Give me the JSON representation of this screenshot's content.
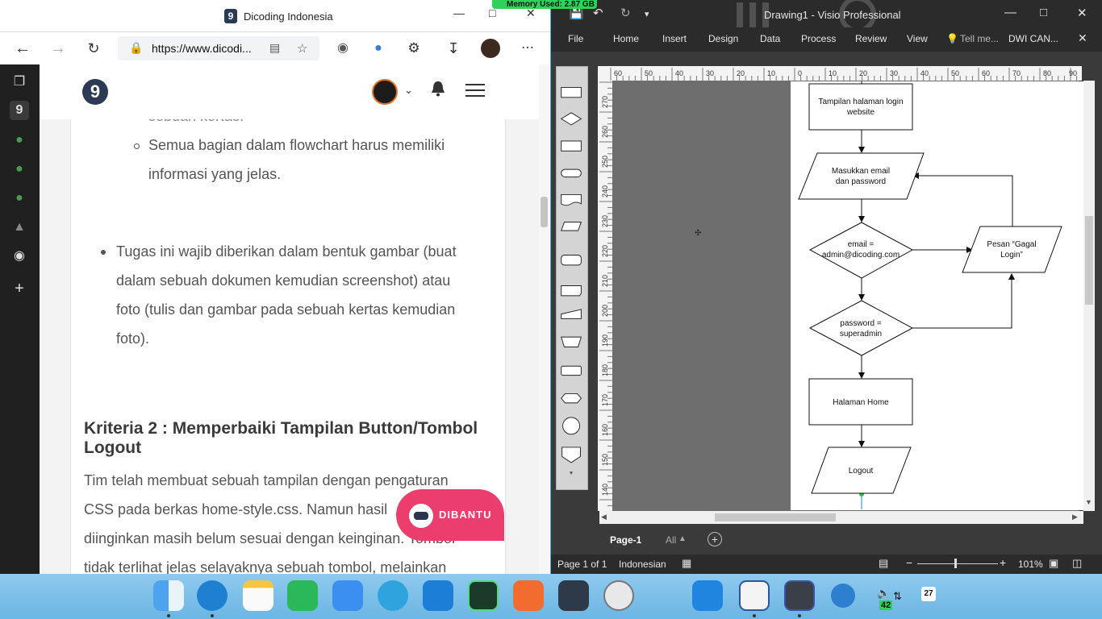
{
  "browser": {
    "tab_title": "Dicoding Indonesia",
    "url": "https://www.dicodi...",
    "memory_badge": "Memory Used: 2.87 GB",
    "article": {
      "cut_line": "sebuah kertas.",
      "sub_bullet": [
        "Semua bagian dalam flowchart harus memiliki",
        "informasi yang jelas."
      ],
      "bullet_lines": [
        "Tugas ini wajib diberikan dalam bentuk gambar (buat",
        "dalam sebuah dokumen kemudian screenshot) atau",
        "foto (tulis dan gambar pada sebuah kertas kemudian",
        "foto)."
      ],
      "heading": "Kriteria 2 : Memperbaiki Tampilan Button/Tombol Logout",
      "para_lines": [
        "Tim telah membuat sebuah tampilan dengan pengaturan",
        "CSS pada berkas home-style.css. Namun hasil",
        "diinginkan masih belum sesuai dengan keinginan. Tombol",
        "tidak terlihat jelas selayaknya sebuah tombol, melainkan"
      ]
    },
    "help_button": "DIBANTU"
  },
  "visio": {
    "window_title": "Drawing1 - Visio Professional",
    "ribbon_tabs": [
      "File",
      "Home",
      "Insert",
      "Design",
      "Data",
      "Process",
      "Review",
      "View"
    ],
    "tell_me": "Tell me...",
    "user": "DWI CAN...",
    "ruler_h": [
      "60",
      "50",
      "40",
      "30",
      "20",
      "10",
      "0",
      "10",
      "20",
      "30",
      "40",
      "50",
      "60",
      "70",
      "80",
      "90"
    ],
    "ruler_v": [
      "270",
      "260",
      "250",
      "240",
      "230",
      "220",
      "210",
      "200",
      "190",
      "180",
      "170",
      "160",
      "150",
      "140"
    ],
    "flowchart": {
      "step1": [
        "Tampilan halaman login",
        "website"
      ],
      "step2": [
        "Masukkan email",
        "dan password"
      ],
      "decision1": [
        "email =",
        "admin@dicoding.com"
      ],
      "fail": [
        "Pesan “Gagal",
        "Login”"
      ],
      "decision2": [
        "password =",
        "superadmin"
      ],
      "home": "Halaman Home",
      "logout": "Logout"
    },
    "page_tab": "Page-1",
    "all_tab": "All",
    "status": {
      "page": "Page 1 of 1",
      "language": "Indonesian",
      "zoom": "101%"
    }
  },
  "dock": {
    "apps": [
      "finder",
      "edge",
      "notes",
      "facetime",
      "mail",
      "telegram",
      "cloud",
      "android-studio",
      "sketchbook",
      "storage",
      "clock",
      "vscode",
      "word",
      "visio",
      "chrome"
    ],
    "battery": "42",
    "calendar_day": "27"
  }
}
